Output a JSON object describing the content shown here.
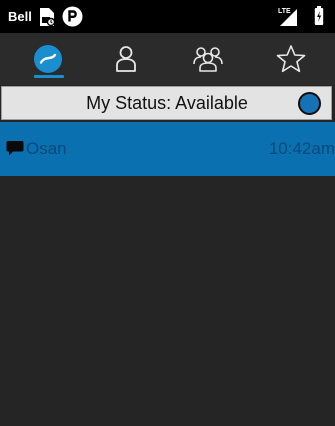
{
  "status_bar": {
    "carrier": "Bell",
    "network_type": "LTE",
    "icons": [
      "sim-card-icon",
      "parking-icon",
      "signal-icon",
      "battery-icon"
    ]
  },
  "tabs": [
    {
      "name": "chats",
      "icon": "chat-bubble-icon",
      "selected": true
    },
    {
      "name": "contacts",
      "icon": "person-icon",
      "selected": false
    },
    {
      "name": "groups",
      "icon": "group-icon",
      "selected": false
    },
    {
      "name": "favorites",
      "icon": "star-icon",
      "selected": false
    }
  ],
  "my_status": {
    "label": "My Status: Available",
    "color": "#1672b4"
  },
  "conversations": [
    {
      "icon": "message-icon",
      "name": "Osan",
      "time": "10:42am"
    }
  ],
  "colors": {
    "accent": "#1a8fd0",
    "selected_row": "#0b70b0",
    "background": "#252525"
  }
}
